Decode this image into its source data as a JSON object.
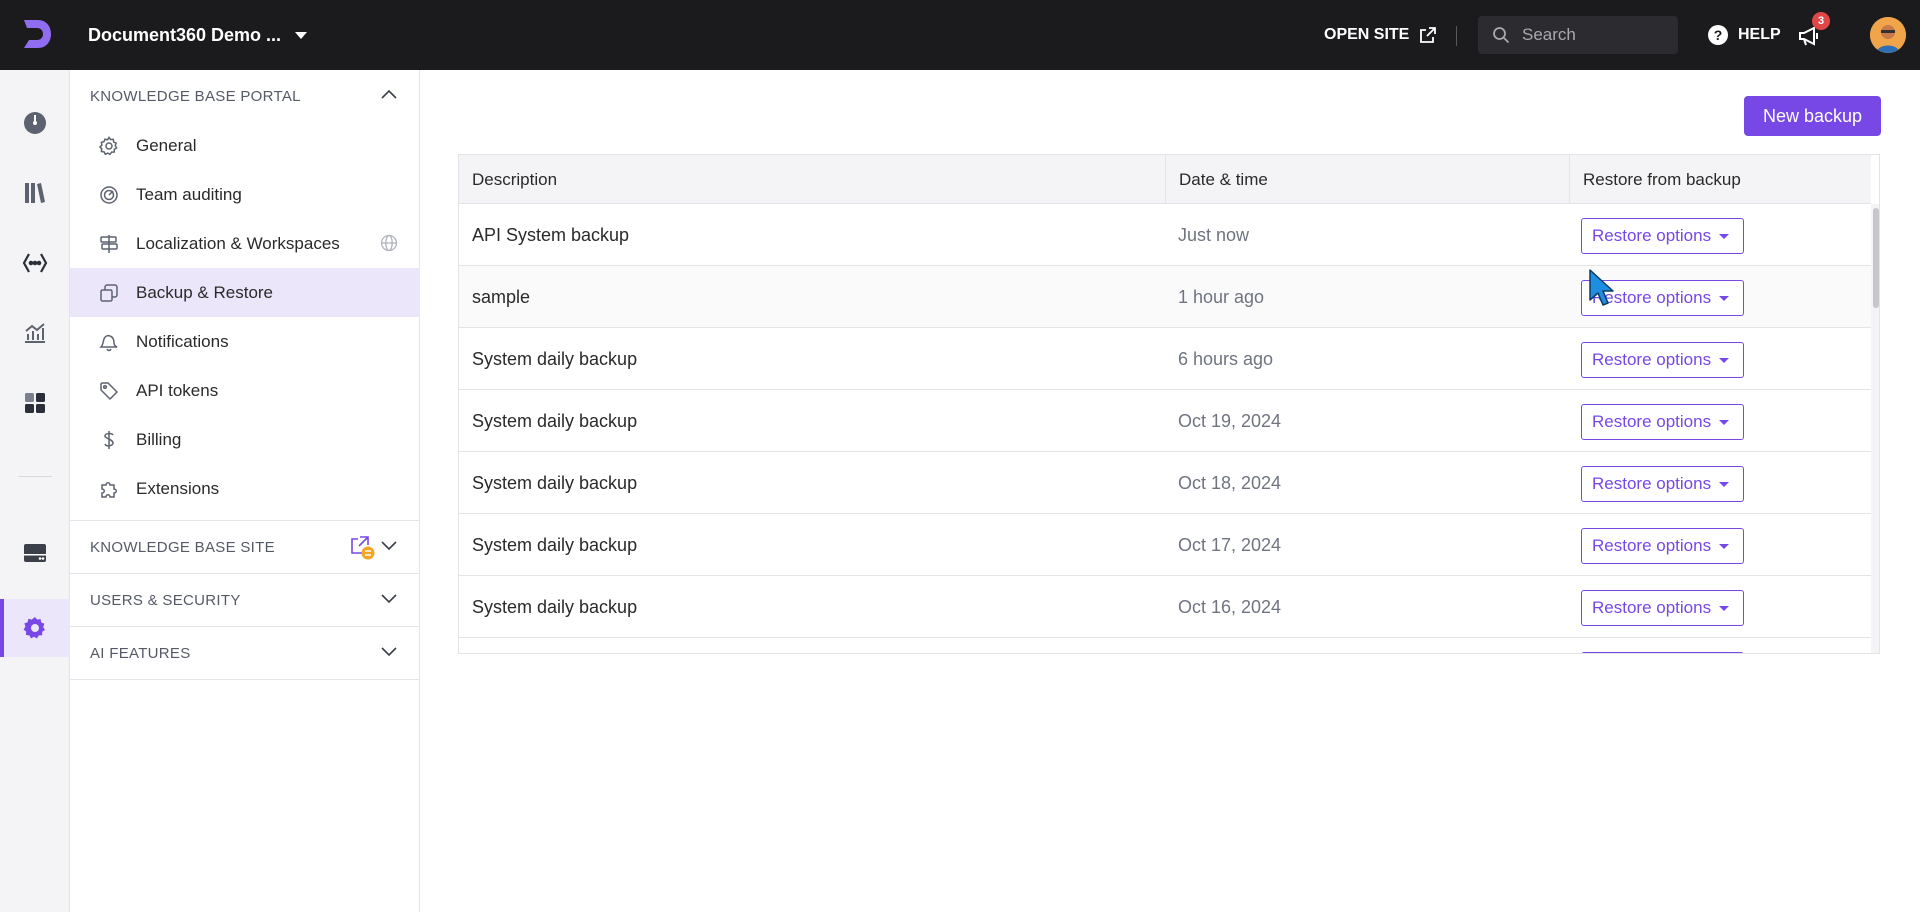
{
  "topbar": {
    "project_name": "Document360 Demo ...",
    "open_site": "OPEN SITE",
    "search_placeholder": "Search",
    "help": "HELP",
    "notifications_count": "3"
  },
  "rail": {
    "icons": [
      "dashboard-icon",
      "documents-icon",
      "api-icon",
      "analytics-icon",
      "widgets-icon",
      "drive-icon",
      "settings-icon"
    ]
  },
  "sidebar": {
    "portal_header": "KNOWLEDGE BASE PORTAL",
    "portal_items": [
      {
        "label": "General",
        "icon": "gear-icon"
      },
      {
        "label": "Team auditing",
        "icon": "audit-icon"
      },
      {
        "label": "Localization & Workspaces",
        "icon": "signpost-icon"
      },
      {
        "label": "Backup & Restore",
        "icon": "backup-icon"
      },
      {
        "label": "Notifications",
        "icon": "notification-icon"
      },
      {
        "label": "API tokens",
        "icon": "tag-icon"
      },
      {
        "label": "Billing",
        "icon": "dollar-icon"
      },
      {
        "label": "Extensions",
        "icon": "puzzle-icon"
      }
    ],
    "site_header": "KNOWLEDGE BASE SITE",
    "users_header": "USERS & SECURITY",
    "ai_header": "AI FEATURES"
  },
  "main": {
    "new_backup": "New backup",
    "columns": [
      "Description",
      "Date & time",
      "Restore from backup"
    ],
    "restore_label": "Restore options",
    "rows": [
      {
        "description": "API System backup",
        "date": "Just now"
      },
      {
        "description": "sample",
        "date": "1 hour ago"
      },
      {
        "description": "System daily backup",
        "date": "6 hours ago"
      },
      {
        "description": "System daily backup",
        "date": "Oct 19, 2024"
      },
      {
        "description": "System daily backup",
        "date": "Oct 18, 2024"
      },
      {
        "description": "System daily backup",
        "date": "Oct 17, 2024"
      },
      {
        "description": "System daily backup",
        "date": "Oct 16, 2024"
      }
    ]
  },
  "colors": {
    "accent": "#7748e6",
    "topbar": "#1b1b1d",
    "active_bg": "#ece6fb"
  }
}
